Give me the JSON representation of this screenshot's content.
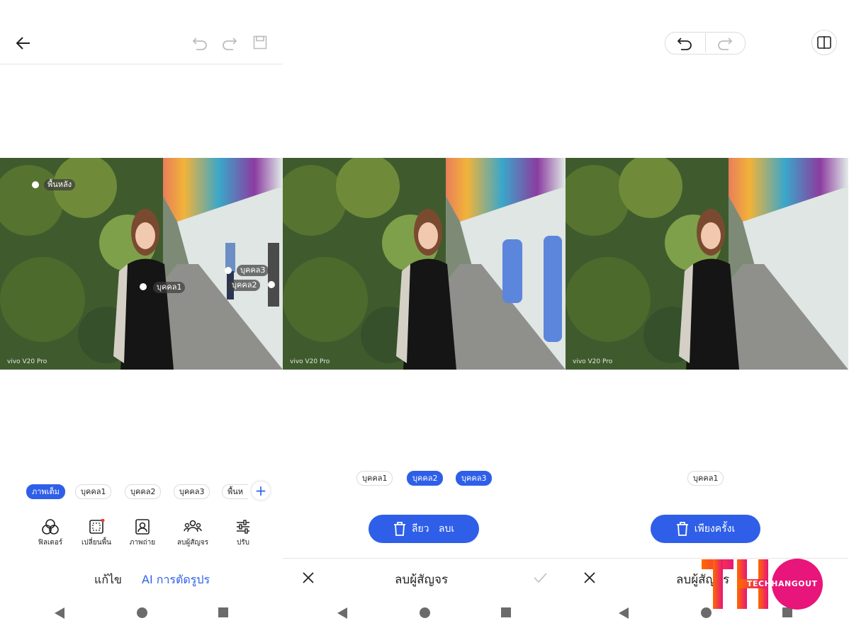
{
  "panel1": {
    "overlay_tags": {
      "background": "พื้นหลัง",
      "person1": "บุคคล1",
      "person2": "บุคคล2",
      "person3": "บุคคล3"
    },
    "watermark": "vivo V20 Pro",
    "chips": [
      "ภาพเต็ม",
      "บุคคล1",
      "บุคคล2",
      "บุคคล3",
      "พื้นห"
    ],
    "tools": [
      {
        "icon": "filter-icon",
        "label": "ฟิลเตอร์"
      },
      {
        "icon": "change-background-icon",
        "label": "เปลี่ยนพื้น"
      },
      {
        "icon": "portrait-icon",
        "label": "ภาพถ่าย"
      },
      {
        "icon": "remove-passerby-icon",
        "label": "ลบผู้สัญจร"
      },
      {
        "icon": "adjust-icon",
        "label": "ปรับ"
      }
    ],
    "bottom_tabs": {
      "edit": "แก้ไข",
      "ai": "AI การตัดรูปร"
    }
  },
  "panel2": {
    "watermark": "vivo V20 Pro",
    "chips": [
      "บุคคล1",
      "บุคคล2",
      "บุคคล3"
    ],
    "delete_button": "ลียว   ลบเ",
    "footer_title": "ลบผู้สัญจร"
  },
  "panel3": {
    "watermark": "vivo V20 Pro",
    "chips": [
      "บุคคล1"
    ],
    "delete_button": "เพียงครั้งเ",
    "footer_title": "ลบผู้สัญจร"
  },
  "logo": {
    "text": "TECHHANGOUT",
    "letters": "THO"
  },
  "colors": {
    "accent": "#2f5fe9",
    "logo_orange": "#ff6a00",
    "logo_pink": "#e8157a"
  }
}
